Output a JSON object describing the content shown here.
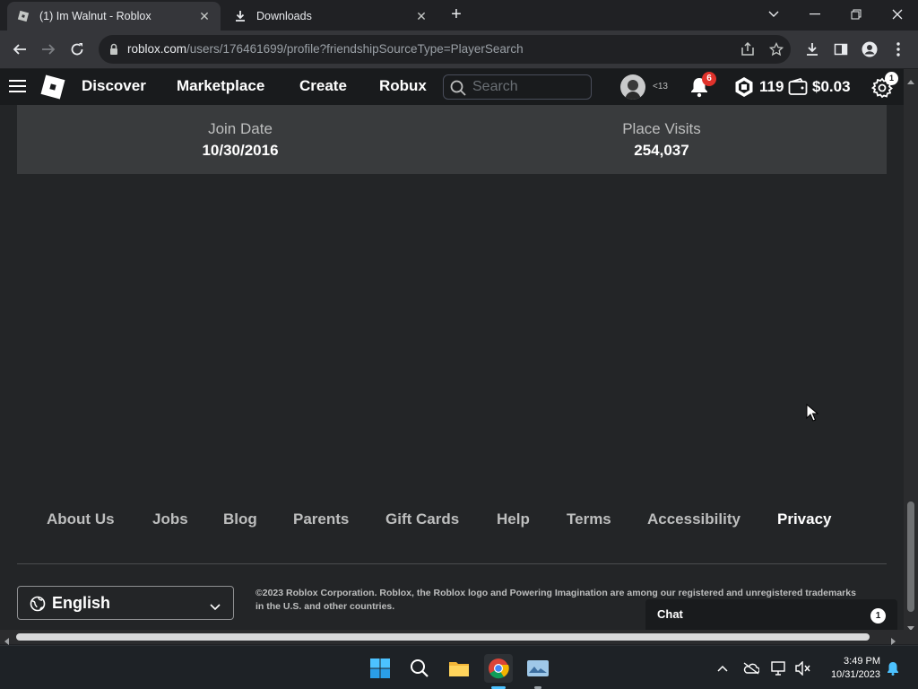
{
  "browser": {
    "tabs": [
      {
        "title": "(1) Im Walnut - Roblox",
        "active": true,
        "icon": "roblox-favicon"
      },
      {
        "title": "Downloads",
        "active": false,
        "icon": "download-icon"
      }
    ],
    "url": {
      "host": "roblox.com",
      "path": "/users/176461699/profile?friendshipSourceType=PlayerSearch"
    }
  },
  "nav": {
    "links": [
      "Discover",
      "Marketplace",
      "Create",
      "Robux"
    ],
    "search_placeholder": "Search",
    "age_label": "<13",
    "notifications_count": "6",
    "robux_amount": "119",
    "wallet_amount": "$0.03",
    "settings_badge": "1"
  },
  "stats": [
    {
      "label": "Join Date",
      "value": "10/30/2016"
    },
    {
      "label": "Place Visits",
      "value": "254,037"
    }
  ],
  "footer": {
    "links": [
      "About Us",
      "Jobs",
      "Blog",
      "Parents",
      "Gift Cards",
      "Help",
      "Terms",
      "Accessibility",
      "Privacy"
    ],
    "language": "English",
    "copyright": "©2023 Roblox Corporation. Roblox, the Roblox logo and Powering Imagination are among our registered and unregistered trademarks in the U.S. and other countries."
  },
  "chat": {
    "label": "Chat",
    "count": "1"
  },
  "taskbar": {
    "time": "3:49 PM",
    "date": "10/31/2023"
  },
  "colors": {
    "page_bg": "#232527",
    "nav_bg": "#191b1d",
    "stats_bg": "#393b3d",
    "badge_red": "#e0322b"
  }
}
